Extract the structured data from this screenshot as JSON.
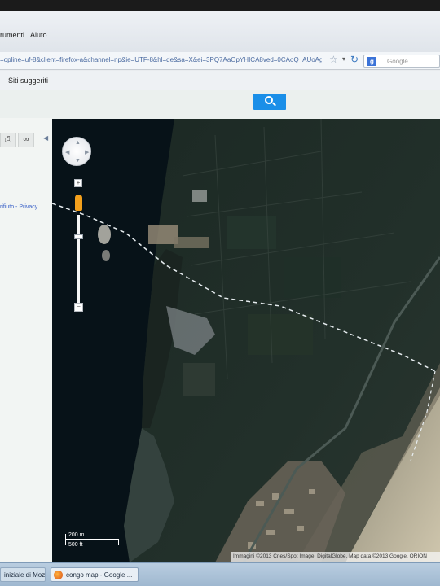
{
  "menu": {
    "items": [
      {
        "label": "rumenti"
      },
      {
        "label": "Aiuto"
      }
    ]
  },
  "urlbar": {
    "url": "=opline=uf-8&client=firefox-a&channel=np&ie=UTF-8&hl=de&sa=X&ei=3PQ7AaOpYHICA8ved=0CAoQ_AUoAg",
    "search_engine": "Google",
    "icons": [
      "star-icon",
      "dropdown-icon",
      "reload-icon",
      "google-icon"
    ]
  },
  "bookmarks": {
    "item": "Siti suggeriti"
  },
  "search_button": {
    "icon": "search-icon",
    "color": "#1a8fe8"
  },
  "left_panel": {
    "tools": [
      "print-icon",
      "link-icon"
    ],
    "link_text": "rifiuto - Privacy"
  },
  "map": {
    "view": "satellite",
    "zoom_level_fraction": 0.2,
    "scale": {
      "metric": "200 m",
      "imperial": "500 ft"
    },
    "attribution": "Immagini ©2013 Cnes/Spot Image, DigitalGlobe, Map data ©2013 Google, ORION"
  },
  "taskbar": {
    "items": [
      {
        "label": "iniziale di Mozil..."
      },
      {
        "label": "congo map - Google ..."
      }
    ]
  }
}
